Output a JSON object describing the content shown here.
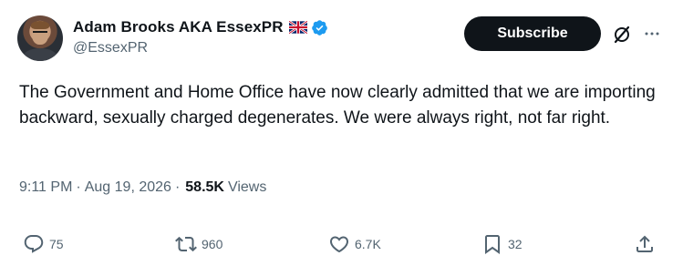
{
  "author": {
    "name": "Adam Brooks AKA EssexPR",
    "handle": "@EssexPR"
  },
  "header": {
    "subscribe_label": "Subscribe"
  },
  "tweet": {
    "text": "The Government and Home Office have now clearly admitted that we are importing backward, sexually charged degenerates. We were always right, not far right.",
    "time": "9:11 PM",
    "separator": "·",
    "date": "Aug 19, 2026",
    "views_count": "58.5K",
    "views_label": "Views"
  },
  "actions": {
    "replies": "75",
    "retweets": "960",
    "likes": "6.7K",
    "bookmarks": "32"
  },
  "icons": {
    "flag": "uk-flag-icon",
    "verified": "verified-badge-icon",
    "grok": "grok-icon",
    "more": "more-icon",
    "reply": "reply-icon",
    "retweet": "retweet-icon",
    "like": "like-icon",
    "bookmark": "bookmark-icon",
    "share": "share-icon"
  },
  "colors": {
    "text": "#0f1419",
    "secondary": "#536471",
    "verified": "#1d9bf0",
    "button": "#0f1419"
  }
}
